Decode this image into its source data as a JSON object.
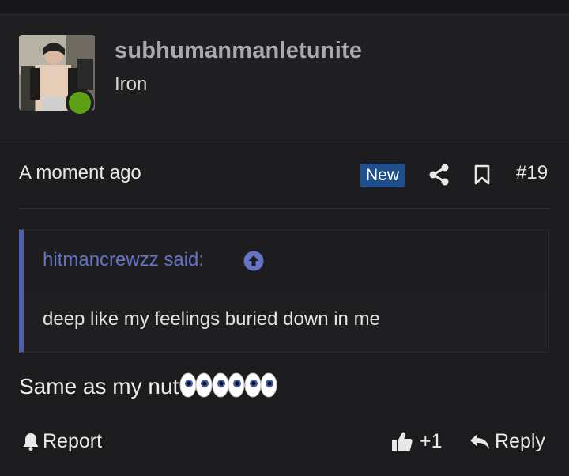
{
  "post": {
    "author": {
      "username": "subhumanmanletunite",
      "title": "Iron",
      "online_status_color": "#5da016",
      "avatar_icon": "user-photo"
    },
    "meta": {
      "timestamp": "A moment ago",
      "badge": "New",
      "badge_color": "#1e4f8c",
      "share_icon": "share-icon",
      "bookmark_icon": "bookmark-icon",
      "number": "#19"
    },
    "quote": {
      "author_label": "hitmancrewzz said:",
      "expand_icon": "arrow-up-circle-icon",
      "text": "deep like my feelings buried down in me",
      "accent_color": "#4f5db3"
    },
    "message": {
      "text": "Same as my nut",
      "emoji": "👀👀👀"
    },
    "actions": {
      "report_label": "Report",
      "like_count": "+1",
      "reply_label": "Reply"
    }
  }
}
